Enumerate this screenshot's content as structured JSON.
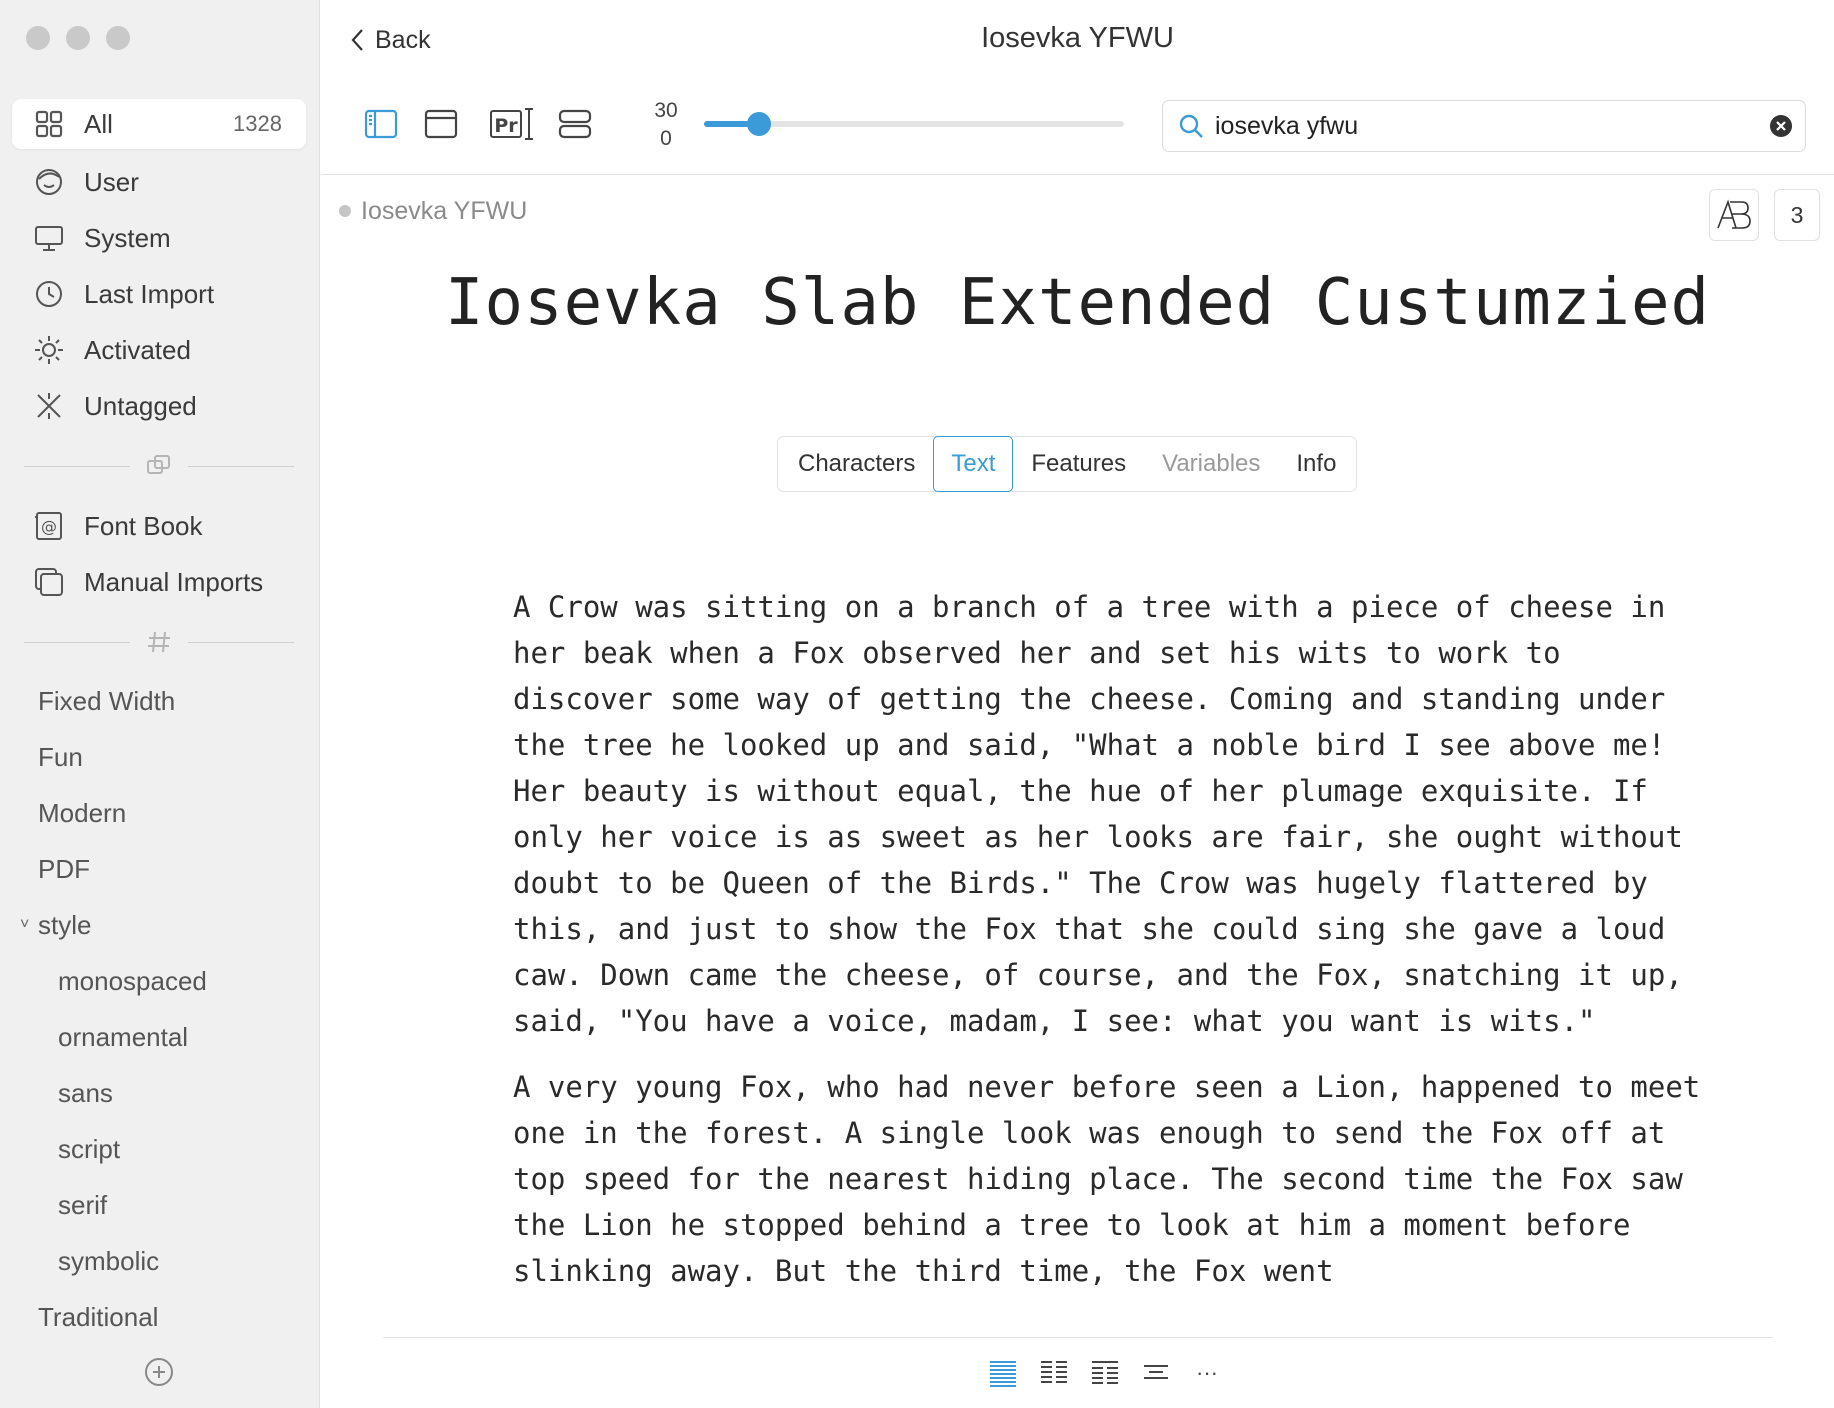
{
  "sidebar": {
    "smart": [
      {
        "label": "All",
        "count": "1328",
        "icon": "grid-icon"
      },
      {
        "label": "User",
        "icon": "user-face-icon"
      },
      {
        "label": "System",
        "icon": "monitor-icon"
      },
      {
        "label": "Last Import",
        "icon": "clock-icon"
      },
      {
        "label": "Activated",
        "icon": "sun-icon"
      },
      {
        "label": "Untagged",
        "icon": "sparkle-icon"
      }
    ],
    "collections": [
      {
        "label": "Font Book",
        "icon": "at-book-icon"
      },
      {
        "label": "Manual Imports",
        "icon": "stacked-squares-icon"
      }
    ],
    "tags": [
      {
        "label": "Fixed Width"
      },
      {
        "label": "Fun"
      },
      {
        "label": "Modern"
      },
      {
        "label": "PDF"
      },
      {
        "label": "style"
      },
      {
        "label": "monospaced"
      },
      {
        "label": "ornamental"
      },
      {
        "label": "sans"
      },
      {
        "label": "script"
      },
      {
        "label": "serif"
      },
      {
        "label": "symbolic"
      },
      {
        "label": "Traditional"
      }
    ]
  },
  "header": {
    "back_label": "Back",
    "title": "Iosevka YFWU"
  },
  "toolbar": {
    "size_value": "30",
    "size_min": "0",
    "size_fraction": 0.13,
    "search_value": "iosevka yfwu",
    "accent": "#3a9bd8"
  },
  "preview": {
    "family_label": "Iosevka YFWU",
    "style_count": "3",
    "font_title": "Iosevka Slab Extended Custumzied",
    "tabs": [
      "Characters",
      "Text",
      "Features",
      "Variables",
      "Info"
    ],
    "active_tab": "Text",
    "paragraphs": [
      "A Crow was sitting on a branch of a tree with a piece of cheese in her beak when a Fox observed her and set his wits to work to discover some way of getting the cheese. Coming and standing under the tree he looked up and said, \"What a noble bird I see above me! Her beauty is without equal, the hue of her plumage exquisite. If only her voice is as sweet as her looks are fair, she ought without doubt to be Queen of the Birds.\" The Crow was hugely flattered by this, and just to show the Fox that she could sing she gave a loud caw. Down came the cheese, of course, and the Fox, snatching it up, said, \"You have a voice, madam, I see: what you want is wits.\"",
      "A very young Fox, who had never before seen a Lion, happened to meet one in the forest. A single look was enough to send the Fox off at top speed for the nearest hiding place. The second time the Fox saw the Lion he stopped behind a tree to look at him a moment before slinking away. But the third time, the Fox went"
    ],
    "more_label": "···"
  }
}
